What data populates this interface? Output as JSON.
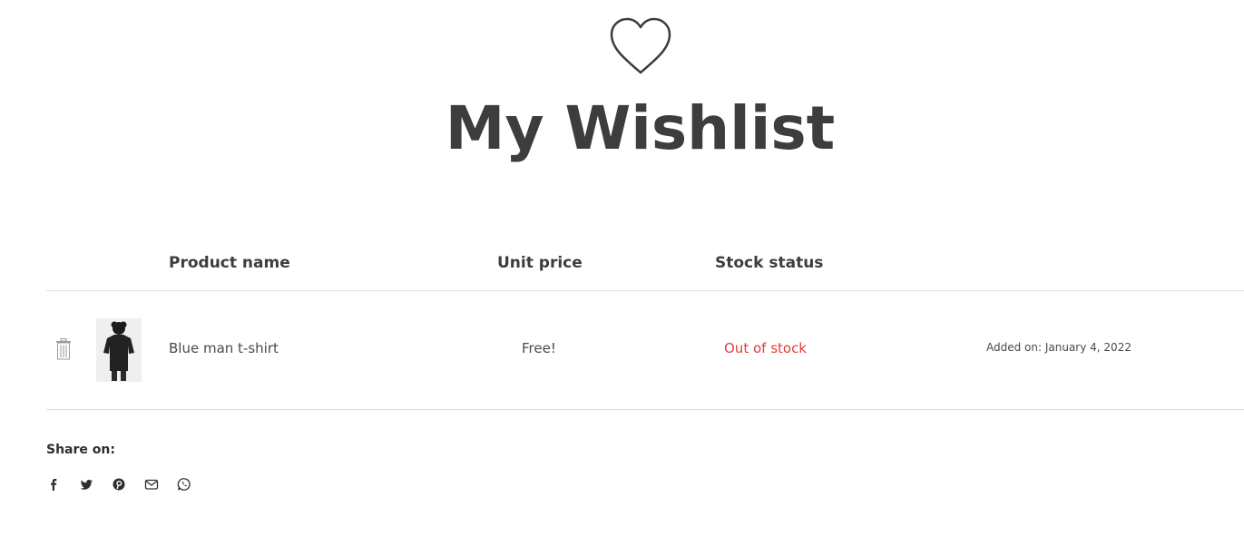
{
  "page": {
    "title": "My Wishlist",
    "heart_icon": "heart-outline-icon",
    "text_color": "#3d3d3d"
  },
  "table": {
    "headers": {
      "product_name": "Product name",
      "unit_price": "Unit price",
      "stock_status": "Stock status"
    },
    "rows": [
      {
        "product_name": "Blue man t-shirt",
        "unit_price": "Free!",
        "stock_status": "Out of stock",
        "stock_status_color": "#e63b3b",
        "added_on": "Added on: January 4, 2022",
        "remove_icon": "trash-icon"
      }
    ]
  },
  "share": {
    "label": "Share on:",
    "icons": [
      "facebook-icon",
      "twitter-icon",
      "pinterest-icon",
      "email-icon",
      "whatsapp-icon"
    ]
  }
}
